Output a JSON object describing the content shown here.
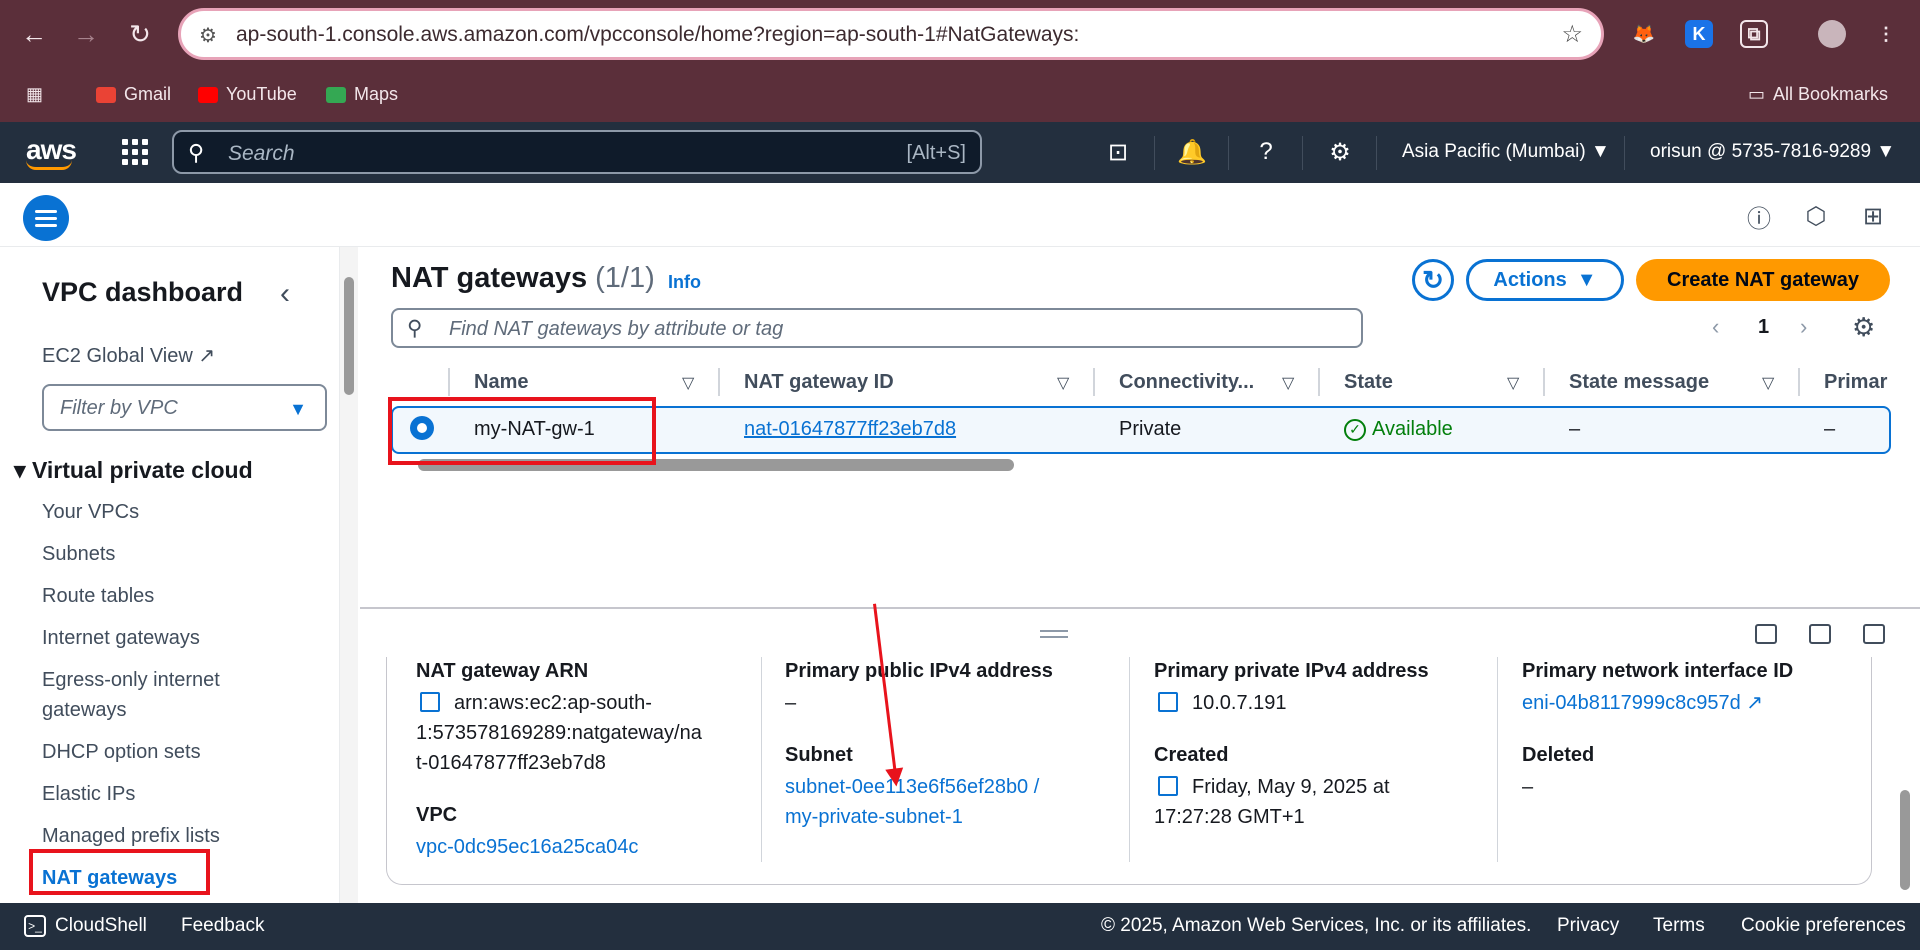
{
  "browser": {
    "url": "ap-south-1.console.aws.amazon.com/vpcconsole/home?region=ap-south-1#NatGateways:",
    "bookmarks": [
      "Gmail",
      "YouTube",
      "Maps"
    ],
    "all_bookmarks": "All Bookmarks"
  },
  "aws_nav": {
    "logo": "aws",
    "search_placeholder": "Search",
    "search_shortcut": "[Alt+S]",
    "region": "Asia Pacific (Mumbai)",
    "account": "orisun @ 5735-7816-9289"
  },
  "sidebar": {
    "title": "VPC dashboard",
    "ec2_global_view": "EC2 Global View",
    "filter_placeholder": "Filter by VPC",
    "section": "Virtual private cloud",
    "items": [
      "Your VPCs",
      "Subnets",
      "Route tables",
      "Internet gateways",
      "Egress-only internet gateways",
      "DHCP option sets",
      "Elastic IPs",
      "Managed prefix lists",
      "NAT gateways"
    ]
  },
  "main": {
    "title": "NAT gateways",
    "count": "(1/1)",
    "info": "Info",
    "actions": "Actions",
    "create": "Create NAT gateway",
    "find_placeholder": "Find NAT gateways by attribute or tag",
    "page": "1",
    "columns": [
      "Name",
      "NAT gateway ID",
      "Connectivity...",
      "State",
      "State message",
      "Primar"
    ],
    "row": {
      "name": "my-NAT-gw-1",
      "id": "nat-01647877ff23eb7d8",
      "connectivity": "Private",
      "state": "Available",
      "state_message": "–",
      "primary": "–"
    }
  },
  "details": {
    "arn_label": "NAT gateway ARN",
    "arn_value_1": "arn:aws:ec2:ap-south-",
    "arn_value_2": "1:573578169289:natgateway/na",
    "arn_value_3": "t-01647877ff23eb7d8",
    "vpc_label": "VPC",
    "vpc_value": "vpc-0dc95ec16a25ca04c",
    "public_ip_label": "Primary public IPv4 address",
    "public_ip_value": "–",
    "subnet_label": "Subnet",
    "subnet_value_1": "subnet-0ee113e6f56ef28b0 /",
    "subnet_value_2": "my-private-subnet-1",
    "private_ip_label": "Primary private IPv4 address",
    "private_ip_value": "10.0.7.191",
    "created_label": "Created",
    "created_value_1": "Friday, May 9, 2025 at",
    "created_value_2": "17:27:28 GMT+1",
    "eni_label": "Primary network interface ID",
    "eni_value": "eni-04b8117999c8c957d",
    "deleted_label": "Deleted",
    "deleted_value": "–"
  },
  "footer": {
    "cloudshell": "CloudShell",
    "feedback": "Feedback",
    "copyright": "© 2025, Amazon Web Services, Inc. or its affiliates.",
    "privacy": "Privacy",
    "terms": "Terms",
    "cookies": "Cookie preferences"
  },
  "colors": {
    "accent": "#0972d3",
    "primary_button": "#ff9900",
    "success": "#037f0c",
    "highlight": "#e8131c"
  }
}
